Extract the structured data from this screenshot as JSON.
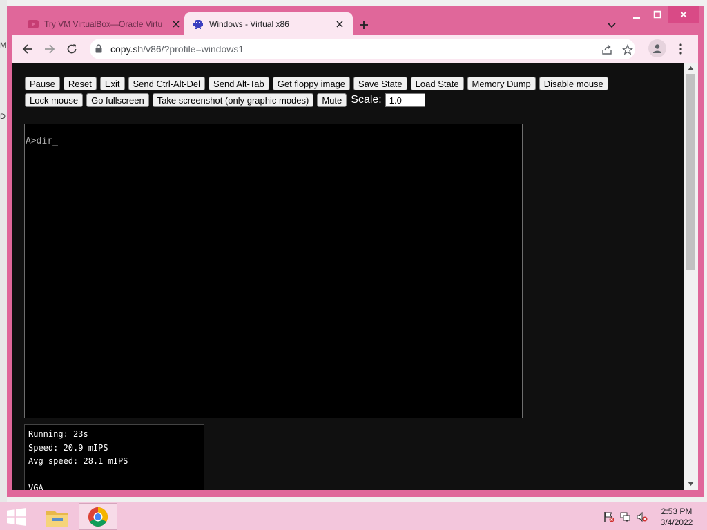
{
  "desktop": {
    "edge_labels": [
      "M",
      "D"
    ]
  },
  "browser": {
    "tabs": [
      {
        "title": "Try VM VirtualBox—Oracle Virtu",
        "active": false
      },
      {
        "title": "Windows - Virtual x86",
        "active": true
      }
    ],
    "url_host": "copy.sh",
    "url_path": "/v86/?profile=windows1"
  },
  "emulator": {
    "buttons_row1": [
      "Pause",
      "Reset",
      "Exit",
      "Send Ctrl-Alt-Del",
      "Send Alt-Tab",
      "Get floppy image",
      "Save State",
      "Load State",
      "Memory Dump",
      "Disable mouse"
    ],
    "buttons_row2": [
      "Lock mouse",
      "Go fullscreen",
      "Take screenshot (only graphic modes)",
      "Mute"
    ],
    "scale_label": "Scale:",
    "scale_value": "1.0",
    "screen_text": "A>dir_",
    "stats": {
      "running": "Running: 23s",
      "speed": "Speed: 20.9 mIPS",
      "avg_speed": "Avg speed: 28.1 mIPS",
      "mode": "VGA"
    }
  },
  "taskbar": {
    "time": "2:53 PM",
    "date": "3/4/2022"
  },
  "colors": {
    "window_frame": "#e0679a",
    "toolbar": "#fbe7f1",
    "page_background": "#101010",
    "taskbar": "#f3c6dc"
  }
}
